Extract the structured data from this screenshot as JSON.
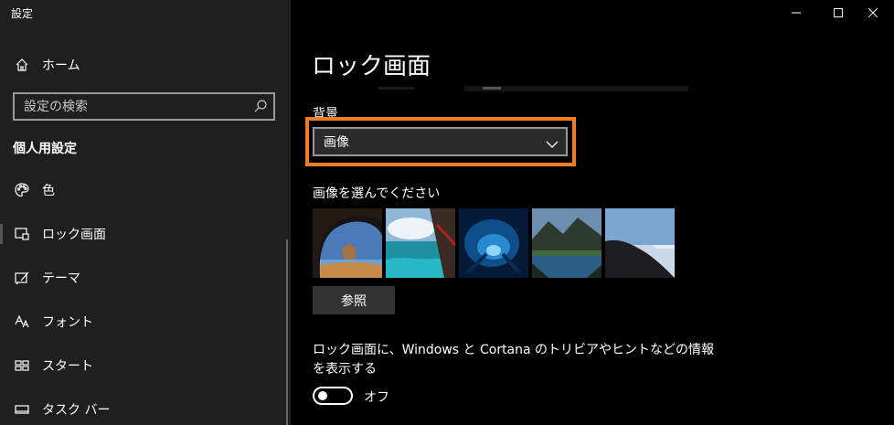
{
  "window": {
    "app_title": "設定",
    "controls": [
      "minimize-icon",
      "maximize-icon",
      "close-icon"
    ]
  },
  "sidebar": {
    "home_label": "ホーム",
    "search": {
      "placeholder": "設定の検索"
    },
    "section_title": "個人用設定",
    "items": [
      {
        "label": "色",
        "icon": "palette-icon"
      },
      {
        "label": "ロック画面",
        "icon": "lock-screen-icon",
        "active": true
      },
      {
        "label": "テーマ",
        "icon": "theme-icon"
      },
      {
        "label": "フォント",
        "icon": "font-icon"
      },
      {
        "label": "スタート",
        "icon": "start-icon"
      },
      {
        "label": "タスク バー",
        "icon": "taskbar-icon"
      }
    ]
  },
  "main": {
    "page_title": "ロック画面",
    "background_label": "背景",
    "background_value": "画像",
    "choose_label": "画像を選んでください",
    "browse_label": "参照",
    "tips_label": "ロック画面に、Windows と Cortana のトリビアやヒントなどの情報を表示する",
    "toggle_state": "オフ",
    "highlight_color": "#f07d22"
  },
  "colors": {
    "sidebar_bg": "#1f1f1f",
    "main_bg": "#000000",
    "accent_highlight": "#f07d22"
  }
}
